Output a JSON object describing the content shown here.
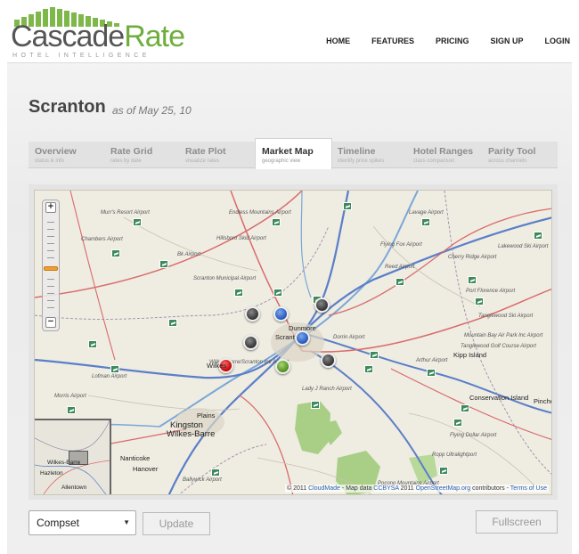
{
  "brand": {
    "name_part1": "Cascade",
    "name_part2": "Rate",
    "tagline": "HOTEL INTELLIGENCE"
  },
  "nav": [
    "HOME",
    "FEATURES",
    "PRICING",
    "SIGN UP",
    "LOGIN"
  ],
  "page": {
    "city": "Scranton",
    "as_of": "as of May 25, 10"
  },
  "tabs": [
    {
      "title": "Overview",
      "subtitle": "status & info",
      "active": false
    },
    {
      "title": "Rate Grid",
      "subtitle": "rates by date",
      "active": false
    },
    {
      "title": "Rate Plot",
      "subtitle": "visualize rates",
      "active": false
    },
    {
      "title": "Market Map",
      "subtitle": "geographic view",
      "active": true
    },
    {
      "title": "Timeline",
      "subtitle": "identify price spikes",
      "active": false
    },
    {
      "title": "Hotel Ranges",
      "subtitle": "class comparison",
      "active": false
    },
    {
      "title": "Parity Tool",
      "subtitle": "across channels",
      "active": false
    }
  ],
  "map": {
    "attribution_prefix": "© 2011 ",
    "attribution_cloudmade": "CloudMade",
    "attribution_mid": " - Map data ",
    "attribution_license": "CCBYSA",
    "attribution_year": " 2011 ",
    "attribution_osm": "OpenStreetMap.org",
    "attribution_suffix": " contributors - ",
    "attribution_terms": "Terms of Use",
    "zoom_in": "+",
    "zoom_out": "−",
    "cities": {
      "dunmore": "Dunmore",
      "scranton": "Scranton",
      "kingston": "Kingston",
      "wilkes_barre": "Wilkes-Barre",
      "plains": "Plains",
      "nanticoke": "Nanticoke",
      "hanover": "Hanover",
      "wilkes_short": "Wilkes",
      "pinchot": "Pinchot",
      "kipp_island": "Kipp Island",
      "conservation_island": "Conservation Island"
    },
    "airports": {
      "a1": "Murr's Resort Airport",
      "a2": "Chambers Airport",
      "a3": "Endless Mountains Airport",
      "a4": "Hillsboro Skid Airport",
      "a5": "Lavage Airport",
      "a6": "Flying Fox Airport",
      "a7": "Cherry Ridge Airport",
      "a8": "Lakewood Ski Airport",
      "a9": "Reed Airport",
      "a10": "Port Florence Airport",
      "a11": "Tanglewood Ski Airport",
      "a12": "Scranton Municipal Airport",
      "a13": "Mountain Bay Air Park Inc Airport",
      "a14": "Tanglewood Golf Course Airport",
      "a15": "Arthur Airport",
      "a16": "Lofman Airport",
      "a17": "Morris Airport",
      "a18": "Lady J Ranch Airport",
      "a19": "Flying Dollar Airport",
      "a20": "Ropp Ultralightport",
      "a21": "Pocono Mountains Airport",
      "a22": "Ballywick Airport",
      "a23": "Dorrin Airport",
      "a24": "Wilkes-Barre/Scranton Intl Airport",
      "a25": "Bk Airport"
    },
    "minimap": {
      "wilkes_barre": "Wilkes-Barre",
      "hazleton": "Hazleton",
      "allentown": "Allentown"
    }
  },
  "controls": {
    "compset": "Compset",
    "update": "Update",
    "fullscreen": "Fullscreen"
  },
  "colors": {
    "brand_green": "#6fae3c",
    "map_land": "#efece2",
    "park_green": "#a9cf86",
    "pin_red": "#c00000",
    "pin_blue": "#2456b8",
    "pin_green": "#4d8c1f",
    "pin_gray": "#333333"
  }
}
